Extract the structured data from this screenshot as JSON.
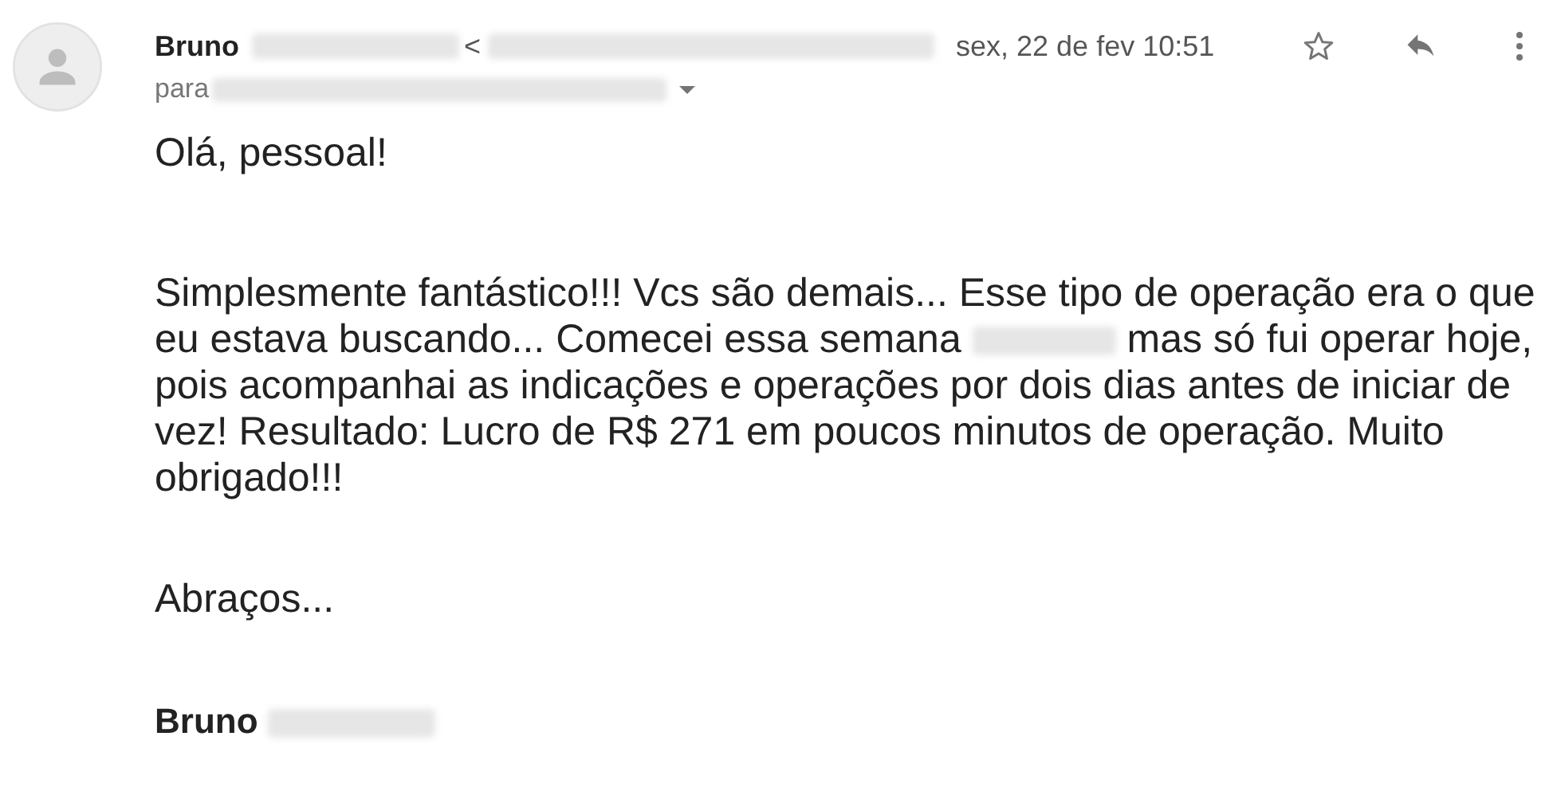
{
  "sender": {
    "first_name": "Bruno",
    "open_bracket": "<"
  },
  "date": "sex, 22 de fev 10:51",
  "starred": false,
  "recipient": {
    "label": "para"
  },
  "body": [
    {
      "parts": [
        {
          "kind": "text",
          "text": "Olá, pessoal!"
        }
      ]
    },
    {
      "parts": [
        {
          "kind": "text",
          "text": "Simplesmente fantástico!!! Vcs são demais... Esse tipo de operação era o que eu estava buscando... Comecei essa semana "
        },
        {
          "kind": "blurred"
        },
        {
          "kind": "text",
          "text": " mas só fui operar hoje, pois acompanhai as indicações e operações por dois dias antes de iniciar de vez! Resultado: Lucro de R$ 271 em poucos minutos de operação. Muito obrigado!!!"
        }
      ]
    },
    {
      "parts": [
        {
          "kind": "text",
          "text": "Abraços..."
        }
      ]
    }
  ],
  "signature": {
    "first_name": "Bruno"
  }
}
